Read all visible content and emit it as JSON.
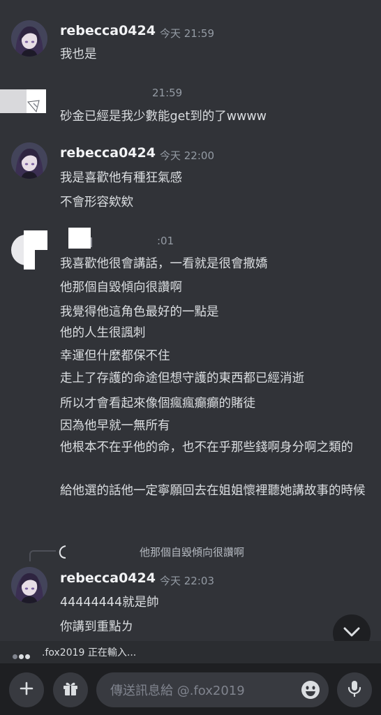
{
  "messages": [
    {
      "username": "rebecca0424",
      "timestamp": "今天 21:59",
      "lines": [
        "我也是"
      ]
    },
    {
      "username": "",
      "timestamp": "21:59",
      "lines": [
        "砂金已經是我少數能get到的了wwww"
      ]
    },
    {
      "username": "rebecca0424",
      "timestamp": "今天 22:00",
      "lines": [
        "我是喜歡他有種狂氣感",
        "不會形容欸欸"
      ]
    },
    {
      "username": "",
      "timestamp": ":01",
      "lines": [
        "我喜歡他很會講話，一看就是很會撒嬌",
        "他那個自毀傾向很讚啊",
        "我覺得他這角色最好的一點是",
        "他的人生很諷刺",
        "幸運但什麼都保不住",
        "走上了存護的命途但想守護的東西都已經消逝",
        "所以才會看起來像個瘋瘋癲癲的賭徒",
        "因為他早就一無所有",
        "他根本不在乎他的命，也不在乎那些錢啊身分啊之類的",
        "給他選的話他一定寧願回去在姐姐懷裡聽她講故事的時候"
      ]
    },
    {
      "username": "rebecca0424",
      "timestamp": "今天 22:03",
      "reply_to": "他那個自毀傾向很讚啊",
      "lines": [
        "44444444就是帥",
        "你講到重點ㄌ"
      ]
    }
  ],
  "typing_indicator": ".fox2019 正在輸入...",
  "composer": {
    "placeholder": "傳送訊息給 @.fox2019"
  },
  "icons": {
    "add": "plus-icon",
    "gift": "gift-icon",
    "emoji": "emoji-icon",
    "mic": "microphone-icon",
    "scroll": "chevron-down-icon"
  },
  "colors": {
    "background": "#313338",
    "bottom_bar": "#1e1f22",
    "text": "#dbdee1",
    "muted": "#949ba4"
  }
}
